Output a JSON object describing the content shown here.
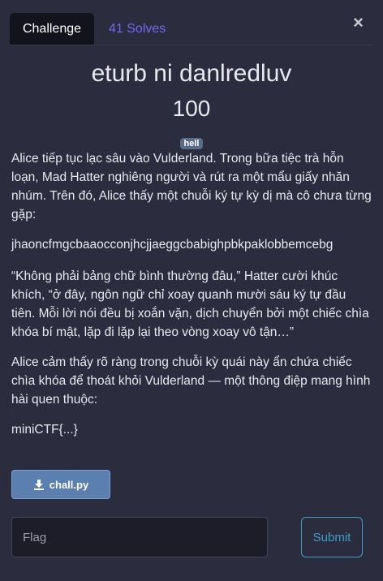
{
  "tabs": {
    "challenge": "Challenge",
    "solves": "41 Solves"
  },
  "close_symbol": "×",
  "challenge": {
    "name": "eturb ni danlredluv",
    "points": "100",
    "tag": "hell",
    "paragraphs": [
      "Alice tiếp tục lạc sâu vào Vulderland. Trong bữa tiệc trà hỗn loạn, Mad Hatter nghiêng người và rút ra một mẩu giấy nhăn nhúm. Trên đó, Alice thấy một chuỗi ký tự kỳ dị mà cô chưa từng gặp:",
      "jhaoncfmgcbaaocconjhcjjaeggcbabighpbkpaklobbemcebg",
      "“Không phải bảng chữ bình thường đâu,” Hatter cười khúc khích, “ở đây, ngôn ngữ chỉ xoay quanh mười sáu ký tự đầu tiên. Mỗi lời nói đều bị xoắn vặn, dịch chuyển bởi một chiếc chìa khóa bí mật, lặp đi lặp lại theo vòng xoay vô tận…”",
      "Alice cảm thấy rõ ràng trong chuỗi kỳ quái này ẩn chứa chiếc chìa khóa để thoát khỏi Vulderland — một thông điệp mang hình hài quen thuộc:",
      "miniCTF{...}"
    ],
    "file": {
      "name": "chall.py",
      "icon": "download-icon"
    }
  },
  "flag_input": {
    "placeholder": "Flag",
    "value": ""
  },
  "submit_label": "Submit",
  "colors": {
    "background": "#2b2c3d",
    "accent": "#7367f0",
    "submit": "#39a0c9",
    "file_button": "#5b7fae",
    "tag": "#5a6b86"
  }
}
